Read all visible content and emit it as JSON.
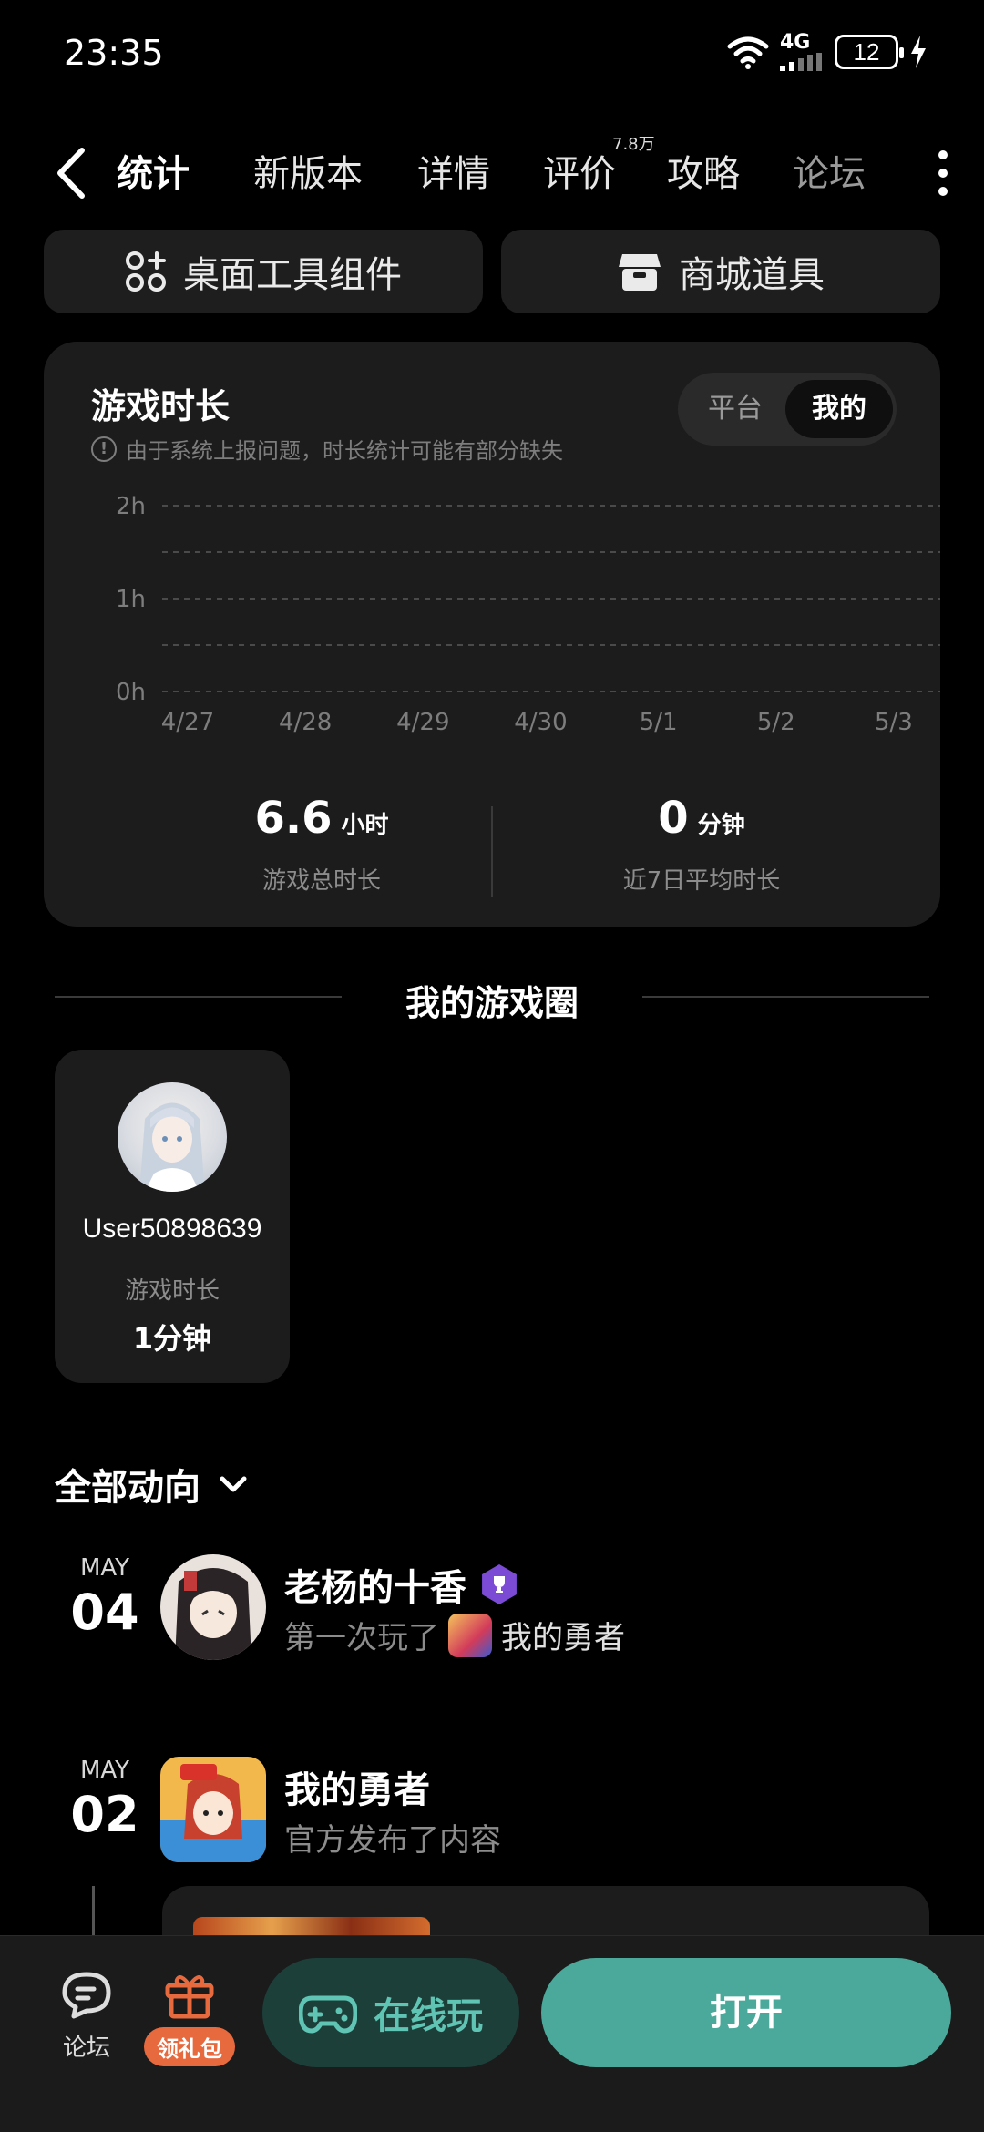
{
  "status_bar": {
    "time": "23:35",
    "network": "4G",
    "battery": "12"
  },
  "tabs": [
    {
      "label": "统计",
      "active": true
    },
    {
      "label": "新版本"
    },
    {
      "label": "详情"
    },
    {
      "label": "评价",
      "badge": "7.8万"
    },
    {
      "label": "攻略"
    },
    {
      "label": "论坛"
    }
  ],
  "tools": {
    "widget_label": "桌面工具组件",
    "shop_label": "商城道具"
  },
  "play_time": {
    "title": "游戏时长",
    "note": "由于系统上报问题，时长统计可能有部分缺失",
    "toggle": {
      "platform": "平台",
      "mine": "我的",
      "selected": "mine"
    },
    "total_value": "6.6",
    "total_unit": "小时",
    "total_label": "游戏总时长",
    "avg_value": "0",
    "avg_unit": "分钟",
    "avg_label": "近7日平均时长"
  },
  "chart_data": {
    "type": "bar",
    "categories": [
      "4/27",
      "4/28",
      "4/29",
      "4/30",
      "5/1",
      "5/2",
      "5/3"
    ],
    "values": [
      0,
      0,
      0,
      0,
      0,
      0,
      0
    ],
    "y_ticks": [
      "2h",
      "1h",
      "0h"
    ],
    "ylim": [
      0,
      2
    ],
    "grid": true
  },
  "circle": {
    "title": "我的游戏圈",
    "friends": [
      {
        "name": "User50898639",
        "label": "游戏时长",
        "value": "1分钟"
      }
    ]
  },
  "dynamics": {
    "header": "全部动向",
    "items": [
      {
        "month": "MAY",
        "day": "04",
        "title": "老杨的十香",
        "action": "第一次玩了",
        "game": "我的勇者"
      },
      {
        "month": "MAY",
        "day": "02",
        "title": "我的勇者",
        "action": "官方发布了内容"
      }
    ]
  },
  "bottom": {
    "forum": "论坛",
    "gift": "领礼包",
    "online": "在线玩",
    "open": "打开"
  },
  "colors": {
    "accent": "#4aa99a",
    "gift": "#e76a3f",
    "card": "#1c1c1c",
    "background": "#000000"
  }
}
